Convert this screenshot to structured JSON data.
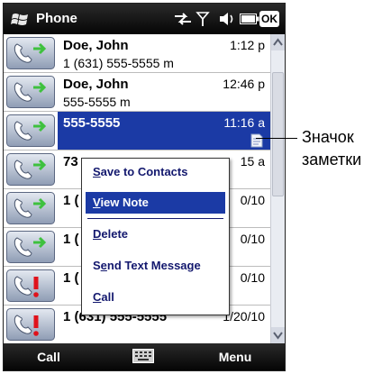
{
  "title_bar": {
    "app_title": "Phone",
    "ok_label": "OK",
    "icons": [
      "windows-flag-icon",
      "data-connection-icon",
      "signal-icon",
      "speaker-icon",
      "battery-icon"
    ]
  },
  "call_log": [
    {
      "name": "Doe, John",
      "detail": "1 (631) 555-5555 m",
      "time": "1:12 p",
      "type": "outgoing",
      "selected": false,
      "has_note": false
    },
    {
      "name": "Doe, John",
      "detail": "555-5555 m",
      "time": "12:46 p",
      "type": "outgoing",
      "selected": false,
      "has_note": false
    },
    {
      "name": "555-5555",
      "detail": "",
      "time": "11:16 a",
      "type": "outgoing",
      "selected": true,
      "has_note": true
    },
    {
      "name": "73",
      "detail": "",
      "time": "15 a",
      "type": "outgoing",
      "selected": false,
      "has_note": false
    },
    {
      "name": "1 (",
      "detail": "",
      "time": "0/10",
      "type": "outgoing",
      "selected": false,
      "has_note": false
    },
    {
      "name": "1 (",
      "detail": "",
      "time": "0/10",
      "type": "outgoing",
      "selected": false,
      "has_note": false
    },
    {
      "name": "1 (",
      "detail": "",
      "time": "0/10",
      "type": "missed",
      "selected": false,
      "has_note": false
    },
    {
      "name": "1 (631) 555-5555",
      "detail": "",
      "time": "1/20/10",
      "type": "missed",
      "selected": false,
      "has_note": false
    }
  ],
  "context_menu": {
    "items": [
      {
        "accel": "S",
        "rest": "ave to Contacts",
        "highlighted": false
      },
      {
        "accel": "V",
        "rest": "iew Note",
        "highlighted": true
      },
      {
        "accel": "D",
        "rest": "elete",
        "highlighted": false
      },
      {
        "pre": "S",
        "accel": "e",
        "rest": "nd Text Message",
        "highlighted": false
      },
      {
        "accel": "C",
        "rest": "all",
        "highlighted": false
      }
    ]
  },
  "softkeys": {
    "left": "Call",
    "right": "Menu",
    "center_icon": "keyboard-icon"
  },
  "callout": {
    "line1": "Значок",
    "line2": "заметки"
  },
  "colors": {
    "selection": "#1b3aa5",
    "menu_text": "#13186e",
    "bar": "#050505",
    "call_green": "#3ec13e",
    "missed_red": "#e0121b"
  }
}
